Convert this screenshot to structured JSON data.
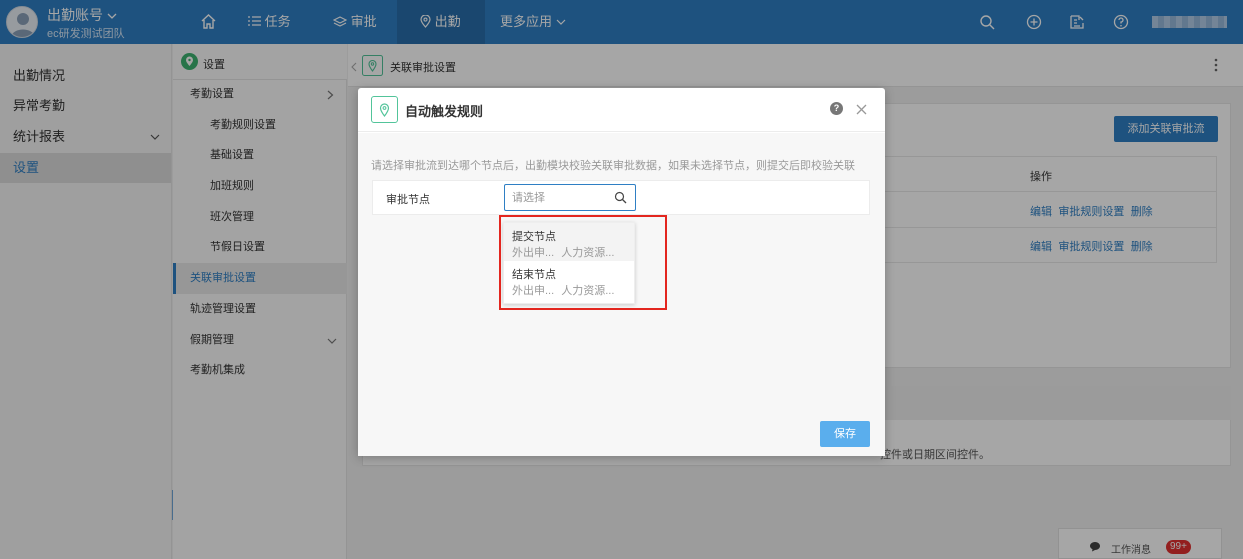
{
  "header": {
    "account": "出勤账号",
    "team": "ec研发测试团队",
    "nav": [
      {
        "label": "任务"
      },
      {
        "label": "审批"
      },
      {
        "label": "出勤"
      },
      {
        "label": "更多应用"
      }
    ],
    "icons": [
      "home-icon",
      "search-icon",
      "plus-circle-icon",
      "edit-icon",
      "help-icon"
    ]
  },
  "sidebar": {
    "items": [
      {
        "label": "出勤情况"
      },
      {
        "label": "异常考勤"
      },
      {
        "label": "统计报表"
      },
      {
        "label": "设置"
      }
    ]
  },
  "menu2": {
    "title": "设置",
    "items": [
      {
        "label": "考勤设置"
      },
      {
        "label": "考勤规则设置"
      },
      {
        "label": "基础设置"
      },
      {
        "label": "加班规则"
      },
      {
        "label": "班次管理"
      },
      {
        "label": "节假日设置"
      },
      {
        "label": "关联审批设置"
      },
      {
        "label": "轨迹管理设置"
      },
      {
        "label": "假期管理"
      },
      {
        "label": "考勤机集成"
      }
    ]
  },
  "main": {
    "title": "关联审批设置",
    "add_button": "添加关联审批流",
    "table": {
      "op_header": "操作",
      "rows": [
        {
          "edit": "编辑",
          "rule": "审批规则设置",
          "delete": "删除"
        },
        {
          "edit": "编辑",
          "rule": "审批规则设置",
          "delete": "删除"
        }
      ]
    },
    "card2_text": "控件或日期区间控件。"
  },
  "dialog": {
    "title": "自动触发规则",
    "hint": "请选择审批流到达哪个节点后，出勤模块校验关联审批数据，如果未选择节点，则提交后即校验关联",
    "node_label": "审批节点",
    "input_placeholder": "请选择",
    "options": [
      {
        "title": "提交节点",
        "sub1": "外出申...",
        "sub2": "人力资源..."
      },
      {
        "title": "结束节点",
        "sub1": "外出申...",
        "sub2": "人力资源..."
      }
    ],
    "save": "保存"
  },
  "footer": {
    "message": "工作消息",
    "badge": "99+"
  },
  "colors": {
    "brand": "#2f7fc4",
    "highlight": "#e3261f",
    "icon_green": "#52c49a"
  }
}
